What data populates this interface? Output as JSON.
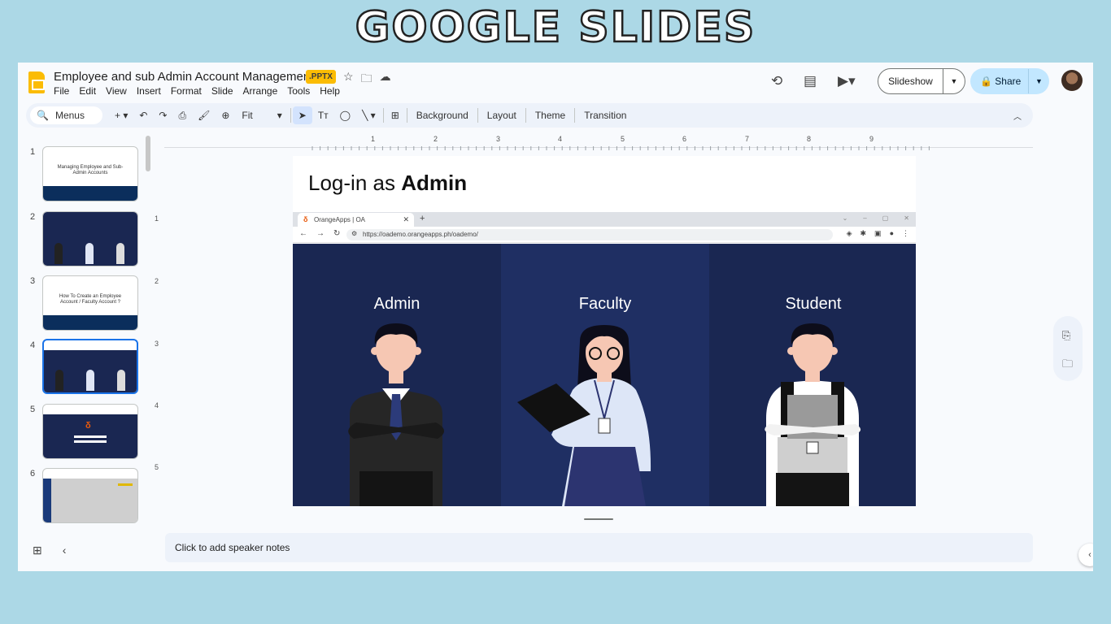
{
  "banner": "GOOGLE SLIDES",
  "header": {
    "doc_title": "Employee and sub Admin Account Management",
    "badge": ".PPTX",
    "menu": [
      "File",
      "Edit",
      "View",
      "Insert",
      "Format",
      "Slide",
      "Arrange",
      "Tools",
      "Help"
    ],
    "slideshow_label": "Slideshow",
    "share_label": "Share"
  },
  "toolbar": {
    "menus_label": "Menus",
    "zoom": "Fit",
    "background": "Background",
    "layout": "Layout",
    "theme": "Theme",
    "transition": "Transition"
  },
  "filmstrip": {
    "slides": [
      {
        "num": "1",
        "text": "Managing Employee and Sub-Admin Accounts"
      },
      {
        "num": "2"
      },
      {
        "num": "3",
        "text": "How To Create an Employee Account / Faculty Account ?"
      },
      {
        "num": "4"
      },
      {
        "num": "5"
      },
      {
        "num": "6"
      }
    ],
    "selected": 4
  },
  "ruler": {
    "top": [
      "1",
      "2",
      "3",
      "4",
      "5",
      "6",
      "7",
      "8",
      "9"
    ],
    "left": [
      "1",
      "2",
      "3",
      "4",
      "5"
    ]
  },
  "slide": {
    "title_normal": "Log-in as ",
    "title_bold": "Admin",
    "browser": {
      "tab_title": "OrangeApps | OA",
      "url": "https://oademo.orangeapps.ph/oademo/"
    },
    "panels": [
      "Admin",
      "Faculty",
      "Student"
    ]
  },
  "notes_placeholder": "Click to add speaker notes",
  "colors": {
    "background": "#acd8e6",
    "accent": "#1a73e8",
    "share": "#c2e7ff",
    "badge": "#fbbc04",
    "panel_dark": "#1a2752",
    "panel_mid": "#1f2f63"
  }
}
